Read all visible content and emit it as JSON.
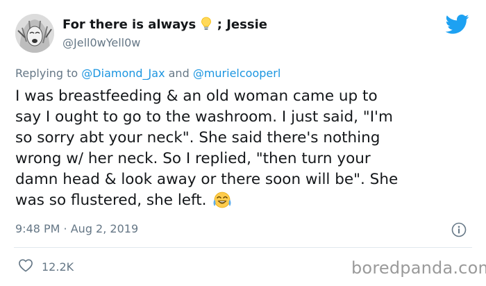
{
  "author": {
    "name_before": "For there is always",
    "name_emoji": "💡",
    "name_after": "; Jessie",
    "handle": "@Jell0wYell0w"
  },
  "icons": {
    "avatar": "avatar",
    "brand": "twitter-bird-icon",
    "info": "info-icon",
    "like": "heart-icon",
    "emoji": "tears-of-joy-emoji"
  },
  "reply": {
    "prefix": "Replying to",
    "mention_1": "@Diamond_Jax",
    "joiner": "and",
    "mention_2": "@murielcooperl"
  },
  "tweet": {
    "lines": [
      "I was breastfeeding & an old woman came up to",
      "say I ought to go to the washroom. I just said, \"I'm",
      "so sorry abt your neck\". She said there's nothing",
      "wrong w/ her neck. So I replied, \"then turn your",
      "damn head & look away or there soon will be\". She",
      "was so flustered, she left."
    ]
  },
  "meta": {
    "timestamp": "9:48 PM · Aug 2, 2019",
    "likes": "12.2K"
  },
  "watermark": "boredpanda.com",
  "colors": {
    "text": "#14171a",
    "secondary": "#657786",
    "link": "#1b95e0",
    "twitter_blue": "#1da1f2",
    "divider": "#e1e8ed"
  }
}
